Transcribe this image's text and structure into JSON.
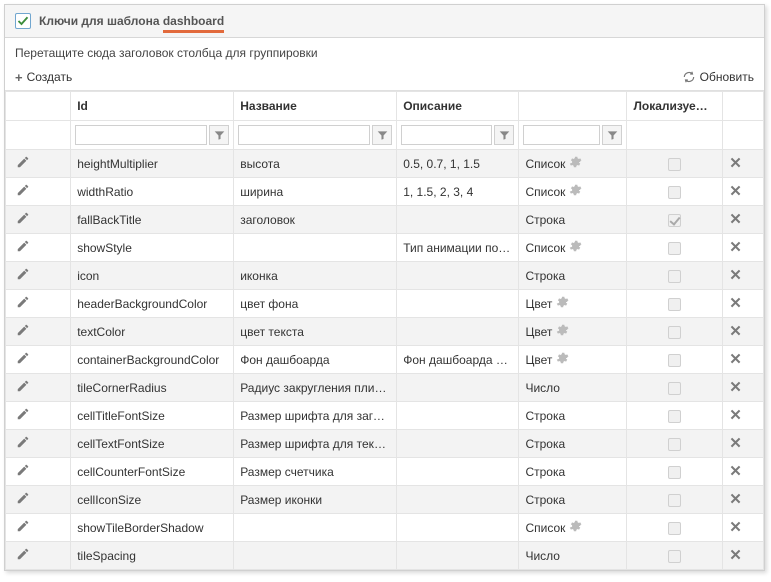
{
  "panel": {
    "title_prefix": "Ключи для шаблона ",
    "title_accent": "dashboard"
  },
  "group_hint": "Перетащите сюда заголовок столбца для группировки",
  "toolbar": {
    "create": "Создать",
    "refresh": "Обновить"
  },
  "columns": {
    "id": "Id",
    "name": "Название",
    "desc": "Описание",
    "loc": "Локализуемый"
  },
  "rows": [
    {
      "id": "heightMultiplier",
      "name": "высота",
      "desc": "0.5, 0.7, 1, 1.5",
      "type": "Список",
      "gear": true,
      "loc": false
    },
    {
      "id": "widthRatio",
      "name": "ширина",
      "desc": "1, 1.5, 2, 3, 4",
      "type": "Список",
      "gear": true,
      "loc": false
    },
    {
      "id": "fallBackTitle",
      "name": "заголовок",
      "desc": "",
      "type": "Строка",
      "gear": false,
      "loc": true
    },
    {
      "id": "showStyle",
      "name": "",
      "desc": "Тип анимации показа",
      "type": "Список",
      "gear": true,
      "loc": false
    },
    {
      "id": "icon",
      "name": "иконка",
      "desc": "",
      "type": "Строка",
      "gear": false,
      "loc": false
    },
    {
      "id": "headerBackgroundColor",
      "name": "цвет фона",
      "desc": "",
      "type": "Цвет",
      "gear": true,
      "loc": false
    },
    {
      "id": "textColor",
      "name": "цвет текста",
      "desc": "",
      "type": "Цвет",
      "gear": true,
      "loc": false
    },
    {
      "id": "containerBackgroundColor",
      "name": "Фон дашбоарда",
      "desc": "Фон дашбоарда под плитками",
      "type": "Цвет",
      "gear": true,
      "loc": false
    },
    {
      "id": "tileCornerRadius",
      "name": "Радиус закругления плиток",
      "desc": "",
      "type": "Число",
      "gear": false,
      "loc": false
    },
    {
      "id": "cellTitleFontSize",
      "name": "Размер шрифта для заголовка",
      "desc": "",
      "type": "Строка",
      "gear": false,
      "loc": false
    },
    {
      "id": "cellTextFontSize",
      "name": "Размер шрифта для текста",
      "desc": "",
      "type": "Строка",
      "gear": false,
      "loc": false
    },
    {
      "id": "cellCounterFontSize",
      "name": "Размер счетчика",
      "desc": "",
      "type": "Строка",
      "gear": false,
      "loc": false
    },
    {
      "id": "cellIconSize",
      "name": "Размер иконки",
      "desc": "",
      "type": "Строка",
      "gear": false,
      "loc": false
    },
    {
      "id": "showTileBorderShadow",
      "name": "",
      "desc": "",
      "type": "Список",
      "gear": true,
      "loc": false
    },
    {
      "id": "tileSpacing",
      "name": "",
      "desc": "",
      "type": "Число",
      "gear": false,
      "loc": false
    }
  ]
}
